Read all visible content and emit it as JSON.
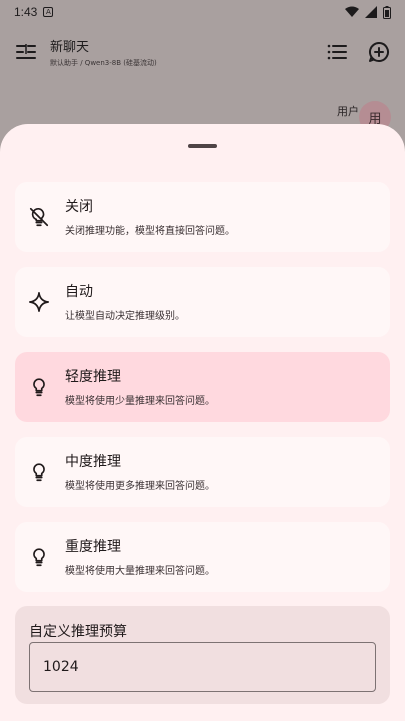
{
  "status": {
    "time": "1:43",
    "notif": "A"
  },
  "topbar": {
    "title": "新聊天",
    "subtitle": "默认助手 / Qwen3-8B (硅基流动)"
  },
  "chat": {
    "user_label": "用户",
    "avatar_text": "用"
  },
  "options": [
    {
      "title": "关闭",
      "desc": "关闭推理功能，模型将直接回答问题。",
      "icon": "lightbulb-off-icon",
      "selected": false
    },
    {
      "title": "自动",
      "desc": "让模型自动决定推理级别。",
      "icon": "sparkle-icon",
      "selected": false
    },
    {
      "title": "轻度推理",
      "desc": "模型将使用少量推理来回答问题。",
      "icon": "lightbulb-icon",
      "selected": true
    },
    {
      "title": "中度推理",
      "desc": "模型将使用更多推理来回答问题。",
      "icon": "lightbulb-icon",
      "selected": false
    },
    {
      "title": "重度推理",
      "desc": "模型将使用大量推理来回答问题。",
      "icon": "lightbulb-icon",
      "selected": false
    }
  ],
  "custom": {
    "label": "自定义推理预算",
    "value": "1024"
  },
  "colors": {
    "sheet": "#fff0f1",
    "card": "#fff7f7",
    "selected": "#ffd9df",
    "custom_bg": "#f1dfe0"
  }
}
